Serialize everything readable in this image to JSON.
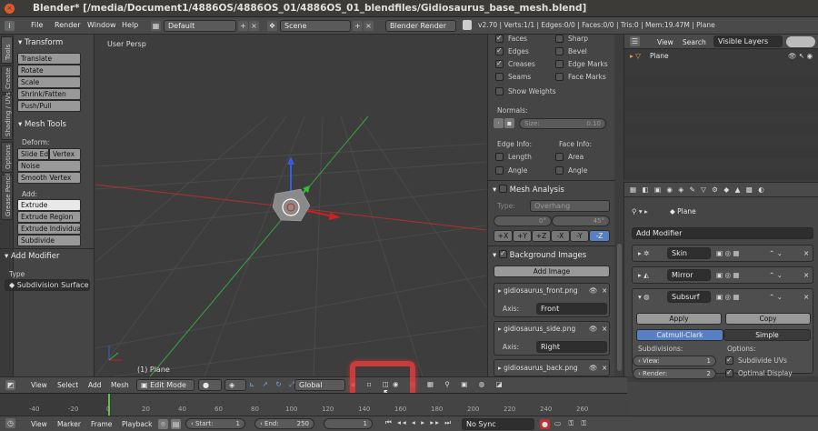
{
  "window": {
    "title": "Blender* [/media/Document1/4886OS/4886OS_01/4886OS_01_blendfiles/Gidiosaurus_base_mesh.blend]"
  },
  "menubar": {
    "items": [
      "File",
      "Render",
      "Window",
      "Help"
    ],
    "layout": "Default",
    "scene": "Scene",
    "engine": "Blender Render",
    "stats": "v2.70 | Verts:1/1 | Edges:0/0 | Faces:0/0 | Tris:0 | Mem:19.47M | Plane"
  },
  "toolshelf": {
    "tabs": [
      "Tools",
      "Create",
      "Shading / UVs",
      "Options",
      "Grease Pencil"
    ],
    "transform_title": "Transform",
    "transform_buttons": [
      "Translate",
      "Rotate",
      "Scale",
      "Shrink/Fatten",
      "Push/Pull"
    ],
    "mesh_tools_title": "Mesh Tools",
    "deform_label": "Deform:",
    "slide_edge": "Slide Ed",
    "vertex": "Vertex",
    "noise": "Noise",
    "smooth_vertex": "Smooth Vertex",
    "add_label": "Add:",
    "add_buttons": [
      "Extrude",
      "Extrude Region",
      "Extrude Individual",
      "Subdivide"
    ],
    "add_modifier_title": "Add Modifier",
    "type_label": "Type",
    "type_value": "Subdivision Surface"
  },
  "viewport": {
    "label": "User Persp",
    "object_label": "(1) Plane"
  },
  "nprops": {
    "display_checks": [
      {
        "label": "Faces",
        "on": true
      },
      {
        "label": "Sharp",
        "on": false
      },
      {
        "label": "Edges",
        "on": true
      },
      {
        "label": "Bevel",
        "on": false
      },
      {
        "label": "Creases",
        "on": true
      },
      {
        "label": "Edge Marks",
        "on": false
      },
      {
        "label": "Seams",
        "on": false
      },
      {
        "label": "Face Marks",
        "on": false
      }
    ],
    "show_weights": "Show Weights",
    "normals_label": "Normals:",
    "size_label": "Size:",
    "size_value": "0.10",
    "edge_info": "Edge Info:",
    "face_info": "Face Info:",
    "length": "Length",
    "area": "Area",
    "angle1": "Angle",
    "angle2": "Angle",
    "mesh_analysis": "Mesh Analysis",
    "type_label": "Type:",
    "type_value": "Overhang",
    "angle_min": "0°",
    "angle_max": "45°",
    "axes": [
      "+X",
      "+Y",
      "+Z",
      "-X",
      "-Y",
      "-Z"
    ],
    "bg_images": "Background Images",
    "add_image": "Add Image",
    "images": [
      {
        "name": "gidiosaurus_front.png",
        "axis": "Front"
      },
      {
        "name": "gidiosaurus_side.png",
        "axis": "Right"
      },
      {
        "name": "gidiosaurus_back.png",
        "axis": ""
      }
    ],
    "axis_label": "Axis:"
  },
  "outliner": {
    "view": "View",
    "search": "Search",
    "filter": "Visible Layers",
    "item": "Plane"
  },
  "properties": {
    "object": "Plane",
    "add_modifier": "Add Modifier",
    "modifiers": [
      "Skin",
      "Mirror",
      "Subsurf"
    ],
    "apply": "Apply",
    "copy": "Copy",
    "catmull": "Catmull-Clark",
    "simple": "Simple",
    "subdivisions": "Subdivisions:",
    "options": "Options:",
    "view_label": "View:",
    "view_value": "1",
    "render_label": "Render:",
    "render_value": "2",
    "subdivide_uvs": "Subdivide UVs",
    "optimal_display": "Optimal Display"
  },
  "header3d": {
    "view": "View",
    "select": "Select",
    "add": "Add",
    "mesh": "Mesh",
    "mode": "Edit Mode",
    "orientation": "Global"
  },
  "timeline": {
    "ticks": [
      "-40",
      "-20",
      "0",
      "20",
      "40",
      "60",
      "80",
      "100",
      "120",
      "140",
      "160",
      "180",
      "200",
      "220",
      "240",
      "260"
    ],
    "view": "View",
    "marker": "Marker",
    "frame": "Frame",
    "playback": "Playback",
    "start": "Start:",
    "start_value": "1",
    "end": "End:",
    "end_value": "250",
    "current": "1",
    "sync": "No Sync"
  },
  "colors": {
    "accent": "#5680c2",
    "highlight": "#e43b3b"
  }
}
